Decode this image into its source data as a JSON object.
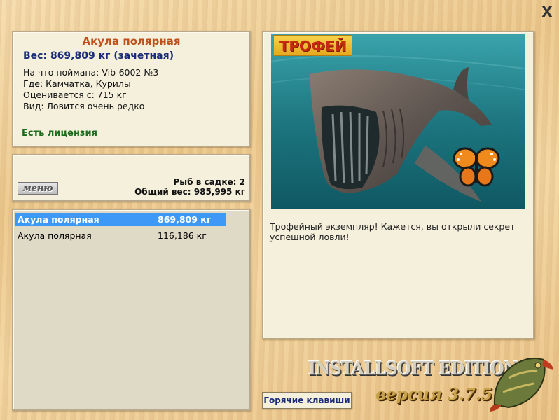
{
  "window": {
    "close_symbol": "X"
  },
  "fish_info": {
    "name": "Акула полярная",
    "weight": "Вес: 869,809 кг (зачетная)",
    "bait": "На что поймана: Vib-6002 №3",
    "location": "Где: Камчатка, Курилы",
    "valued_from": "Оценивается с: 715 кг",
    "rarity": "Вид: Ловится очень редко",
    "license": "Есть лицензия"
  },
  "cage": {
    "menu_label": "меню",
    "count": "Рыб в садке: 2",
    "total": "Общий вес: 985,995 кг"
  },
  "catch_list": [
    {
      "name": "Акула полярная",
      "weight": "869,809 кг",
      "selected": true
    },
    {
      "name": "Акула полярная",
      "weight": "116,186 кг",
      "selected": false
    }
  ],
  "trophy": {
    "badge": "ТРОФЕЙ",
    "description": "Трофейный экземпляр! Кажется, вы открыли секрет успешной ловли!"
  },
  "footer": {
    "hotkeys_label": "Горячие клавиши",
    "edition": "INSTALLSOFT EDITION",
    "version": "версия 3.7.5"
  },
  "colors": {
    "fish_name": "#c0501a",
    "weight": "#1a2b7a",
    "license": "#1a6b1a",
    "selection": "#3d99f5",
    "panel_bg": "#f5f0dc"
  },
  "icons": [
    "close-icon",
    "shark-photo",
    "butterfly-icon",
    "pike-logo-icon"
  ]
}
